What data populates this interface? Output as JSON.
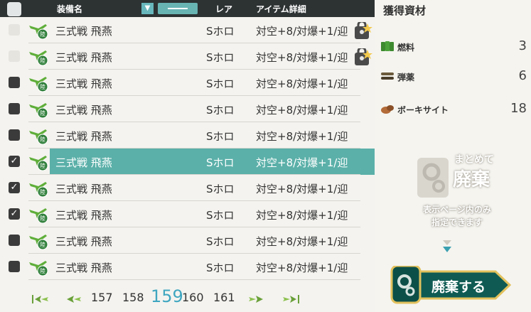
{
  "header": {
    "name_label": "装備名",
    "sort_arrow": "▼",
    "rarity_label": "レア",
    "detail_label": "アイテム詳細"
  },
  "rows": [
    {
      "name": "三式戦 飛燕",
      "rarity": "Sホロ",
      "detail": "対空+8/対爆+1/迎",
      "state": "locked"
    },
    {
      "name": "三式戦 飛燕",
      "rarity": "Sホロ",
      "detail": "対空+8/対爆+1/迎",
      "state": "locked"
    },
    {
      "name": "三式戦 飛燕",
      "rarity": "Sホロ",
      "detail": "対空+8/対爆+1/迎",
      "state": "unchecked"
    },
    {
      "name": "三式戦 飛燕",
      "rarity": "Sホロ",
      "detail": "対空+8/対爆+1/迎",
      "state": "unchecked"
    },
    {
      "name": "三式戦 飛燕",
      "rarity": "Sホロ",
      "detail": "対空+8/対爆+1/迎",
      "state": "unchecked"
    },
    {
      "name": "三式戦 飛燕",
      "rarity": "Sホロ",
      "detail": "対空+8/対爆+1/迎",
      "state": "checked-selected"
    },
    {
      "name": "三式戦 飛燕",
      "rarity": "Sホロ",
      "detail": "対空+8/対爆+1/迎",
      "state": "checked"
    },
    {
      "name": "三式戦 飛燕",
      "rarity": "Sホロ",
      "detail": "対空+8/対爆+1/迎",
      "state": "checked"
    },
    {
      "name": "三式戦 飛燕",
      "rarity": "Sホロ",
      "detail": "対空+8/対爆+1/迎",
      "state": "unchecked"
    },
    {
      "name": "三式戦 飛燕",
      "rarity": "Sホロ",
      "detail": "対空+8/対爆+1/迎",
      "state": "unchecked"
    }
  ],
  "pager": {
    "pages": [
      "157",
      "158",
      "159",
      "160",
      "161"
    ],
    "current": "159"
  },
  "panel": {
    "title": "獲得資材",
    "resources": [
      {
        "label": "燃料",
        "value": "3",
        "icon": "fuel-icon"
      },
      {
        "label": "弾薬",
        "value": "6",
        "icon": "ammo-icon"
      },
      {
        "label": "ボーキサイト",
        "value": "18",
        "icon": "bauxite-icon"
      }
    ],
    "bulk_title_1": "まとめて",
    "bulk_title_2": "廃棄",
    "bulk_note_1": "表示ページ内のみ",
    "bulk_note_2": "指定できます",
    "scrap_label": "廃棄する"
  },
  "colors": {
    "header_bg": "#2d3233",
    "accent": "#5bb0a9",
    "pager_current": "#3fa6c0",
    "scrap_btn": "#0f5b53"
  }
}
